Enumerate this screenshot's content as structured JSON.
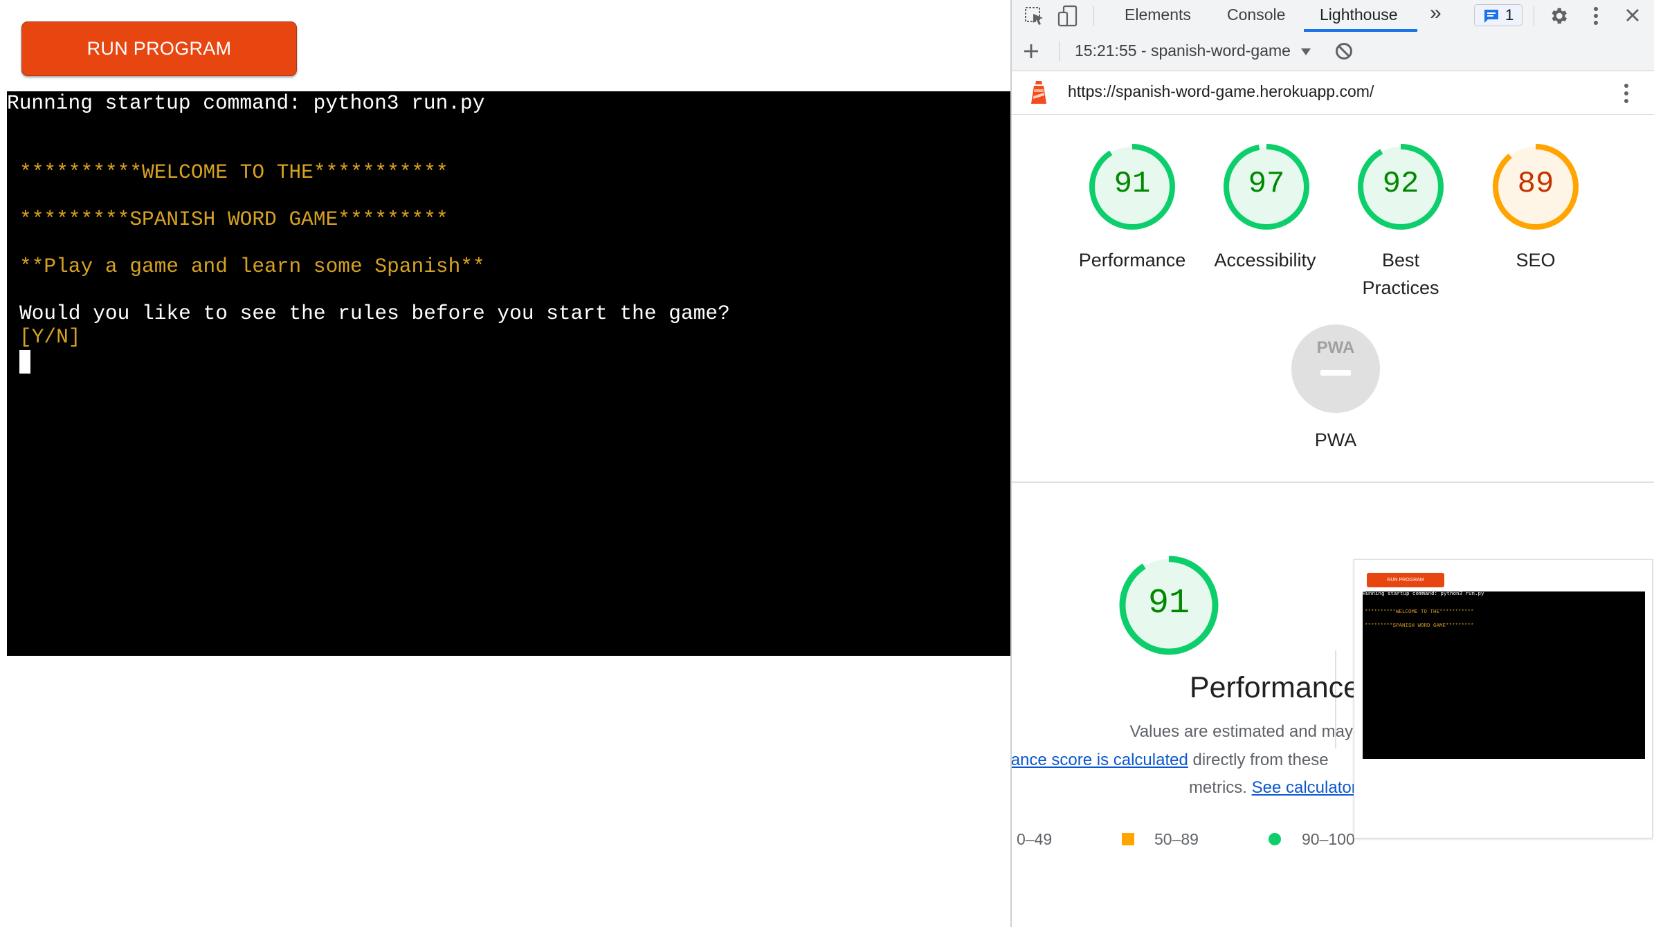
{
  "app": {
    "run_button": "RUN PROGRAM",
    "terminal": {
      "startup": "Running startup command: python3 run.py",
      "welcome1": "**********WELCOME TO THE***********",
      "welcome2": "*********SPANISH WORD GAME*********",
      "tagline": "**Play a game and learn some Spanish**",
      "question": "Would you like to see the rules before you start the game?",
      "prompt": "[Y/N]"
    }
  },
  "devtools": {
    "tabs": [
      "Elements",
      "Console",
      "Lighthouse"
    ],
    "active_tab": "Lighthouse",
    "more_tabs": "»",
    "issues_count": "1",
    "report_selector": "15:21:55 - spanish-word-game",
    "url": "https://spanish-word-game.herokuapp.com/",
    "scores": [
      {
        "label": "Performance",
        "value": 91,
        "status": "pass"
      },
      {
        "label": "Accessibility",
        "value": 97,
        "status": "pass"
      },
      {
        "label": "Best Practices",
        "value": 92,
        "status": "pass"
      },
      {
        "label": "SEO",
        "value": 89,
        "status": "average"
      }
    ],
    "pwa": {
      "label": "PWA",
      "badge": "PWA"
    },
    "performance": {
      "score": 91,
      "title": "Performance",
      "desc_line1": "Values are estimated and may vary. The",
      "desc_link1": "performance score is calculated",
      "desc_after_link1": " directly from these",
      "desc_line3_prefix": "metrics. ",
      "desc_link2": "See calculator."
    },
    "legend": [
      {
        "range": "0–49",
        "color": "#ff4e42"
      },
      {
        "range": "50–89",
        "color": "#ffa400"
      },
      {
        "range": "90–100",
        "color": "#0cce6b"
      }
    ],
    "thumbnail": {
      "button": "RUN PROGRAM",
      "line1": "Running startup command: python3 run.py",
      "line2": "**********WELCOME TO THE***********",
      "line3": "*********SPANISH WORD GAME*********"
    },
    "colors": {
      "pass_ring": "#0cce6b",
      "pass_text": "#008800",
      "pass_fill": "#e7f9ee",
      "average_ring": "#ffa400",
      "average_text": "#c33300",
      "average_fill": "#fff5e6",
      "accent": "#1a73e8"
    }
  }
}
